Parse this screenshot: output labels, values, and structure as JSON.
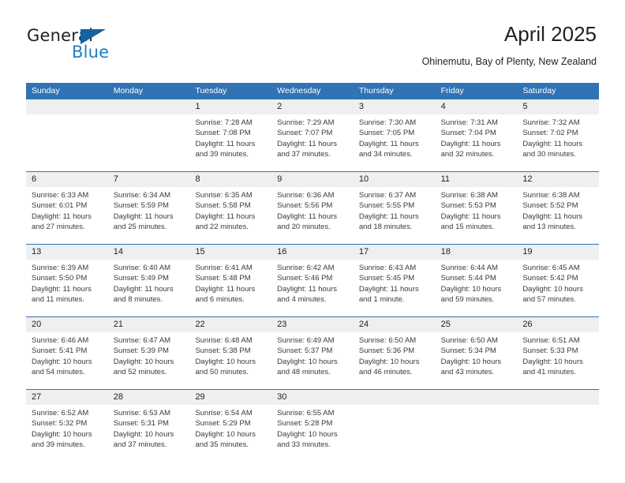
{
  "brand": {
    "name_part1": "General",
    "name_part2": "Blue",
    "triangle_color": "#1063a5",
    "blue_color": "#1d7fc4"
  },
  "header": {
    "title": "April 2025",
    "subtitle": "Ohinemutu, Bay of Plenty, New Zealand"
  },
  "theme": {
    "header_blue": "#3173b4",
    "date_band": "#efefef",
    "text": "#3a3a3a"
  },
  "weekdays": [
    "Sunday",
    "Monday",
    "Tuesday",
    "Wednesday",
    "Thursday",
    "Friday",
    "Saturday"
  ],
  "weeks": [
    {
      "dates": [
        "",
        "",
        "1",
        "2",
        "3",
        "4",
        "5"
      ],
      "cells": [
        {
          "empty": true,
          "sunrise": "",
          "sunset": "",
          "daylight_1": "",
          "daylight_2": ""
        },
        {
          "empty": true,
          "sunrise": "",
          "sunset": "",
          "daylight_1": "",
          "daylight_2": ""
        },
        {
          "empty": false,
          "sunrise": "Sunrise: 7:28 AM",
          "sunset": "Sunset: 7:08 PM",
          "daylight_1": "Daylight: 11 hours",
          "daylight_2": "and 39 minutes."
        },
        {
          "empty": false,
          "sunrise": "Sunrise: 7:29 AM",
          "sunset": "Sunset: 7:07 PM",
          "daylight_1": "Daylight: 11 hours",
          "daylight_2": "and 37 minutes."
        },
        {
          "empty": false,
          "sunrise": "Sunrise: 7:30 AM",
          "sunset": "Sunset: 7:05 PM",
          "daylight_1": "Daylight: 11 hours",
          "daylight_2": "and 34 minutes."
        },
        {
          "empty": false,
          "sunrise": "Sunrise: 7:31 AM",
          "sunset": "Sunset: 7:04 PM",
          "daylight_1": "Daylight: 11 hours",
          "daylight_2": "and 32 minutes."
        },
        {
          "empty": false,
          "sunrise": "Sunrise: 7:32 AM",
          "sunset": "Sunset: 7:02 PM",
          "daylight_1": "Daylight: 11 hours",
          "daylight_2": "and 30 minutes."
        }
      ]
    },
    {
      "dates": [
        "6",
        "7",
        "8",
        "9",
        "10",
        "11",
        "12"
      ],
      "cells": [
        {
          "empty": false,
          "sunrise": "Sunrise: 6:33 AM",
          "sunset": "Sunset: 6:01 PM",
          "daylight_1": "Daylight: 11 hours",
          "daylight_2": "and 27 minutes."
        },
        {
          "empty": false,
          "sunrise": "Sunrise: 6:34 AM",
          "sunset": "Sunset: 5:59 PM",
          "daylight_1": "Daylight: 11 hours",
          "daylight_2": "and 25 minutes."
        },
        {
          "empty": false,
          "sunrise": "Sunrise: 6:35 AM",
          "sunset": "Sunset: 5:58 PM",
          "daylight_1": "Daylight: 11 hours",
          "daylight_2": "and 22 minutes."
        },
        {
          "empty": false,
          "sunrise": "Sunrise: 6:36 AM",
          "sunset": "Sunset: 5:56 PM",
          "daylight_1": "Daylight: 11 hours",
          "daylight_2": "and 20 minutes."
        },
        {
          "empty": false,
          "sunrise": "Sunrise: 6:37 AM",
          "sunset": "Sunset: 5:55 PM",
          "daylight_1": "Daylight: 11 hours",
          "daylight_2": "and 18 minutes."
        },
        {
          "empty": false,
          "sunrise": "Sunrise: 6:38 AM",
          "sunset": "Sunset: 5:53 PM",
          "daylight_1": "Daylight: 11 hours",
          "daylight_2": "and 15 minutes."
        },
        {
          "empty": false,
          "sunrise": "Sunrise: 6:38 AM",
          "sunset": "Sunset: 5:52 PM",
          "daylight_1": "Daylight: 11 hours",
          "daylight_2": "and 13 minutes."
        }
      ]
    },
    {
      "dates": [
        "13",
        "14",
        "15",
        "16",
        "17",
        "18",
        "19"
      ],
      "cells": [
        {
          "empty": false,
          "sunrise": "Sunrise: 6:39 AM",
          "sunset": "Sunset: 5:50 PM",
          "daylight_1": "Daylight: 11 hours",
          "daylight_2": "and 11 minutes."
        },
        {
          "empty": false,
          "sunrise": "Sunrise: 6:40 AM",
          "sunset": "Sunset: 5:49 PM",
          "daylight_1": "Daylight: 11 hours",
          "daylight_2": "and 8 minutes."
        },
        {
          "empty": false,
          "sunrise": "Sunrise: 6:41 AM",
          "sunset": "Sunset: 5:48 PM",
          "daylight_1": "Daylight: 11 hours",
          "daylight_2": "and 6 minutes."
        },
        {
          "empty": false,
          "sunrise": "Sunrise: 6:42 AM",
          "sunset": "Sunset: 5:46 PM",
          "daylight_1": "Daylight: 11 hours",
          "daylight_2": "and 4 minutes."
        },
        {
          "empty": false,
          "sunrise": "Sunrise: 6:43 AM",
          "sunset": "Sunset: 5:45 PM",
          "daylight_1": "Daylight: 11 hours",
          "daylight_2": "and 1 minute."
        },
        {
          "empty": false,
          "sunrise": "Sunrise: 6:44 AM",
          "sunset": "Sunset: 5:44 PM",
          "daylight_1": "Daylight: 10 hours",
          "daylight_2": "and 59 minutes."
        },
        {
          "empty": false,
          "sunrise": "Sunrise: 6:45 AM",
          "sunset": "Sunset: 5:42 PM",
          "daylight_1": "Daylight: 10 hours",
          "daylight_2": "and 57 minutes."
        }
      ]
    },
    {
      "dates": [
        "20",
        "21",
        "22",
        "23",
        "24",
        "25",
        "26"
      ],
      "cells": [
        {
          "empty": false,
          "sunrise": "Sunrise: 6:46 AM",
          "sunset": "Sunset: 5:41 PM",
          "daylight_1": "Daylight: 10 hours",
          "daylight_2": "and 54 minutes."
        },
        {
          "empty": false,
          "sunrise": "Sunrise: 6:47 AM",
          "sunset": "Sunset: 5:39 PM",
          "daylight_1": "Daylight: 10 hours",
          "daylight_2": "and 52 minutes."
        },
        {
          "empty": false,
          "sunrise": "Sunrise: 6:48 AM",
          "sunset": "Sunset: 5:38 PM",
          "daylight_1": "Daylight: 10 hours",
          "daylight_2": "and 50 minutes."
        },
        {
          "empty": false,
          "sunrise": "Sunrise: 6:49 AM",
          "sunset": "Sunset: 5:37 PM",
          "daylight_1": "Daylight: 10 hours",
          "daylight_2": "and 48 minutes."
        },
        {
          "empty": false,
          "sunrise": "Sunrise: 6:50 AM",
          "sunset": "Sunset: 5:36 PM",
          "daylight_1": "Daylight: 10 hours",
          "daylight_2": "and 46 minutes."
        },
        {
          "empty": false,
          "sunrise": "Sunrise: 6:50 AM",
          "sunset": "Sunset: 5:34 PM",
          "daylight_1": "Daylight: 10 hours",
          "daylight_2": "and 43 minutes."
        },
        {
          "empty": false,
          "sunrise": "Sunrise: 6:51 AM",
          "sunset": "Sunset: 5:33 PM",
          "daylight_1": "Daylight: 10 hours",
          "daylight_2": "and 41 minutes."
        }
      ]
    },
    {
      "dates": [
        "27",
        "28",
        "29",
        "30",
        "",
        "",
        ""
      ],
      "cells": [
        {
          "empty": false,
          "sunrise": "Sunrise: 6:52 AM",
          "sunset": "Sunset: 5:32 PM",
          "daylight_1": "Daylight: 10 hours",
          "daylight_2": "and 39 minutes."
        },
        {
          "empty": false,
          "sunrise": "Sunrise: 6:53 AM",
          "sunset": "Sunset: 5:31 PM",
          "daylight_1": "Daylight: 10 hours",
          "daylight_2": "and 37 minutes."
        },
        {
          "empty": false,
          "sunrise": "Sunrise: 6:54 AM",
          "sunset": "Sunset: 5:29 PM",
          "daylight_1": "Daylight: 10 hours",
          "daylight_2": "and 35 minutes."
        },
        {
          "empty": false,
          "sunrise": "Sunrise: 6:55 AM",
          "sunset": "Sunset: 5:28 PM",
          "daylight_1": "Daylight: 10 hours",
          "daylight_2": "and 33 minutes."
        },
        {
          "empty": true,
          "sunrise": "",
          "sunset": "",
          "daylight_1": "",
          "daylight_2": ""
        },
        {
          "empty": true,
          "sunrise": "",
          "sunset": "",
          "daylight_1": "",
          "daylight_2": ""
        },
        {
          "empty": true,
          "sunrise": "",
          "sunset": "",
          "daylight_1": "",
          "daylight_2": ""
        }
      ]
    }
  ]
}
